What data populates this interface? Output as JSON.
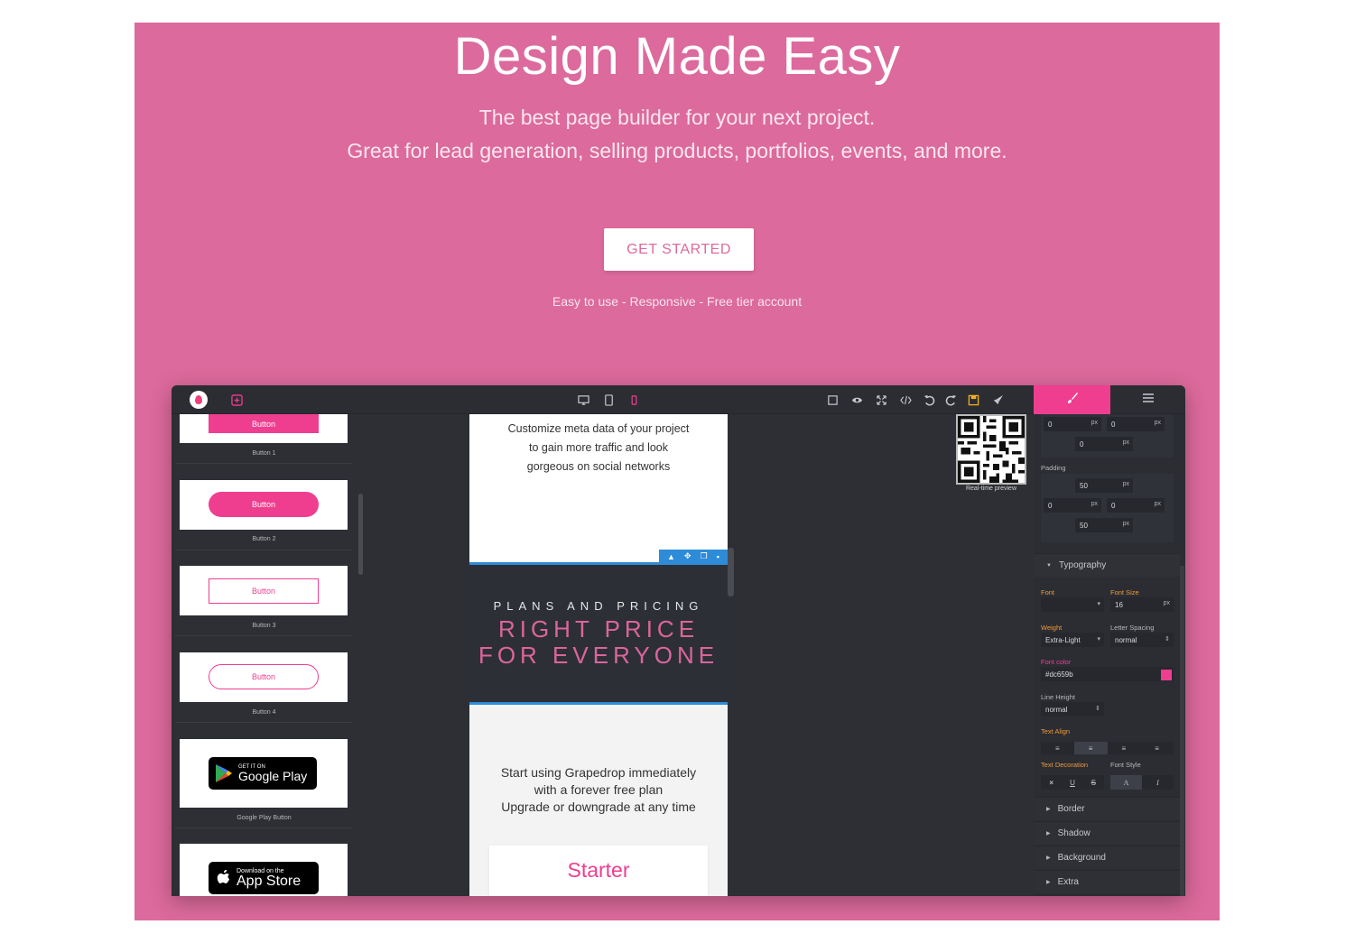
{
  "hero": {
    "title": "Design Made Easy",
    "subtitle_line1": "The best page builder for your next project.",
    "subtitle_line2": "Great for lead generation, selling products, portfolios, events, and more.",
    "cta_label": "GET STARTED",
    "tagline": "Easy to use - Responsive - Free tier account"
  },
  "colors": {
    "hero_bg": "#dc6a9c",
    "accent_pink": "#ef3e8f",
    "editor_dark": "#2d2f35",
    "selection_blue": "#2e8bd8"
  },
  "blocks_panel": {
    "items": [
      {
        "button_label": "Button",
        "caption": "Button 1"
      },
      {
        "button_label": "Button",
        "caption": "Button 2"
      },
      {
        "button_label": "Button",
        "caption": "Button 3"
      },
      {
        "button_label": "Button",
        "caption": "Button 4"
      },
      {
        "badge_small": "GET IT ON",
        "badge_big": "Google Play",
        "caption": "Google Play Button"
      },
      {
        "badge_small": "Download on the",
        "badge_big": "App Store"
      }
    ]
  },
  "canvas": {
    "meta_line1": "Customize meta data of your project",
    "meta_line2": "to gain more traffic and look",
    "meta_line3": "gorgeous on social networks",
    "pricing_kicker": "PLANS AND PRICING",
    "pricing_title_line1": "RIGHT PRICE",
    "pricing_title_line2": "FOR EVERYONE",
    "start_line1": "Start using Grapedrop immediately",
    "start_line2": "with a forever free plan",
    "start_line3": "Upgrade or downgrade at any time",
    "starter_title": "Starter",
    "qr_caption": "Real-time preview"
  },
  "style_manager": {
    "margin": {
      "top": "0",
      "right": "0",
      "bottom": "0",
      "unit": "px"
    },
    "padding_label": "Padding",
    "padding": {
      "top": "50",
      "left": "0",
      "right": "0",
      "bottom": "50",
      "unit": "px"
    },
    "typography_label": "Typography",
    "font_label": "Font",
    "font_value": "",
    "font_size_label": "Font Size",
    "font_size_value": "16",
    "font_size_unit": "px",
    "weight_label": "Weight",
    "weight_value": "Extra-Light",
    "letter_spacing_label": "Letter Spacing",
    "letter_spacing_value": "normal",
    "font_color_label": "Font color",
    "font_color_value": "#dc659b",
    "line_height_label": "Line Height",
    "line_height_value": "normal",
    "text_align_label": "Text Align",
    "text_decoration_label": "Text Decoration",
    "font_style_label": "Font Style",
    "sectors": [
      "Border",
      "Shadow",
      "Background",
      "Extra"
    ]
  }
}
